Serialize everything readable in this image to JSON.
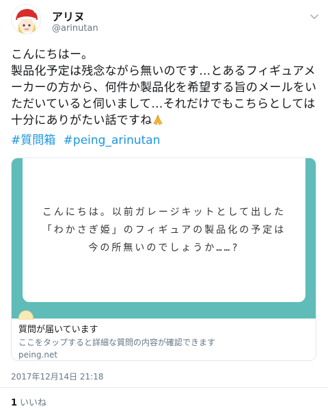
{
  "user": {
    "display_name": "アリヌ",
    "handle": "@arinutan"
  },
  "tweet": {
    "text": "こんにちはー。\n製品化予定は残念ながら無いのです…とあるフィギュアメーカーの方から、何件か製品化を希望する旨のメールをいただいていると伺いまして…それだけでもこちらとしては十分にありがたい話ですね",
    "emoji_icon": "folded-hands-icon",
    "hashtags": [
      "#質問箱",
      "#peing_arinutan"
    ]
  },
  "card": {
    "question_text": "こんにちは。以前ガレージキットとして出した\n「わかさぎ姫」のフィギュアの製品化の予定は\n今の所無いのでしょうか……?",
    "title": "質問が届いています",
    "description": "ここをタップすると詳細な質問の内容が確認できます",
    "domain": "peing.net",
    "image_color": "#5fbcb8"
  },
  "meta": {
    "timestamp": "2017年12月14日 21:18",
    "like_count": "1",
    "like_label": "いいね"
  },
  "colors": {
    "link": "#1b95e0",
    "secondary_text": "#657786"
  }
}
